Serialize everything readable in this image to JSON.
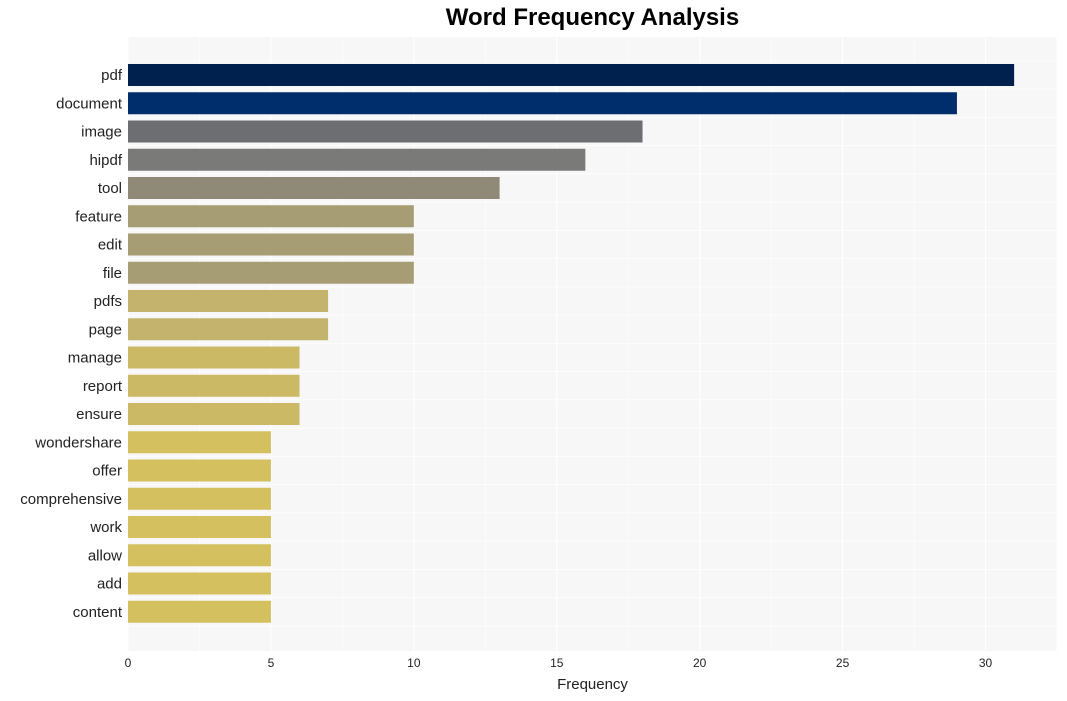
{
  "chart_data": {
    "type": "bar",
    "orientation": "horizontal",
    "title": "Word Frequency Analysis",
    "xlabel": "Frequency",
    "ylabel": "",
    "xlim": [
      0,
      32.5
    ],
    "xticks": [
      0,
      5,
      10,
      15,
      20,
      25,
      30
    ],
    "grid": true,
    "categories": [
      "pdf",
      "document",
      "image",
      "hipdf",
      "tool",
      "feature",
      "edit",
      "file",
      "pdfs",
      "page",
      "manage",
      "report",
      "ensure",
      "wondershare",
      "offer",
      "comprehensive",
      "work",
      "allow",
      "add",
      "content"
    ],
    "values": [
      31,
      29,
      18,
      16,
      13,
      10,
      10,
      10,
      7,
      7,
      6,
      6,
      6,
      5,
      5,
      5,
      5,
      5,
      5,
      5
    ],
    "colors": [
      "#00204e",
      "#002e6c",
      "#6d6e72",
      "#7a7a78",
      "#8f8a78",
      "#a69d75",
      "#a69d75",
      "#a69d75",
      "#c4b36d",
      "#c4b36d",
      "#cbb966",
      "#cbb966",
      "#cbb966",
      "#d4c05f",
      "#d4c05f",
      "#d4c05f",
      "#d4c05f",
      "#d4c05f",
      "#d4c05f",
      "#d4c05f"
    ],
    "background": "#f7f7f7",
    "gridline_color": "#ffffff"
  }
}
